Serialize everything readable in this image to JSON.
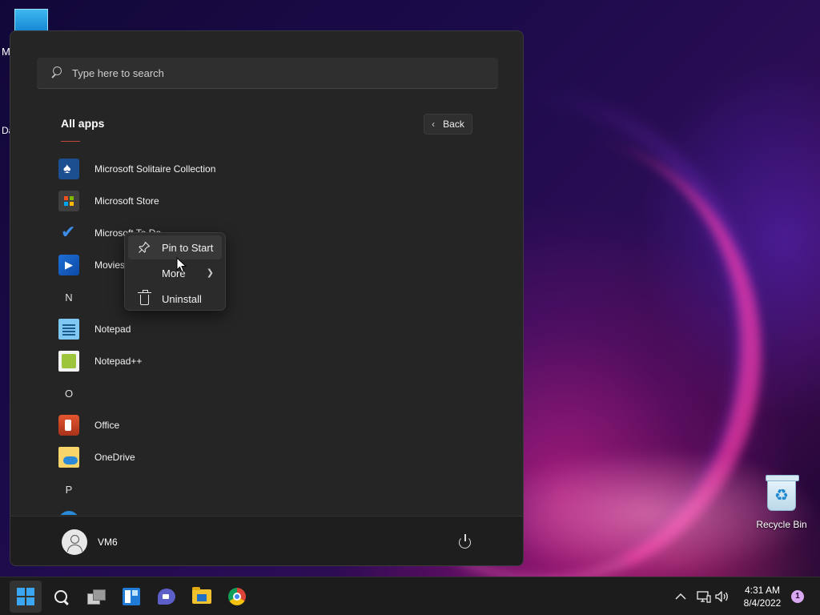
{
  "desktop": {
    "top_label_fragment": "M",
    "side_label_fragment": "Da",
    "recycle_bin_label": "Recycle Bin"
  },
  "start_menu": {
    "search": {
      "placeholder": "Type here to search",
      "value": ""
    },
    "title": "All apps",
    "back_label": "Back",
    "apps": [
      {
        "kind": "app",
        "label": "Microsoft Solitaire Collection",
        "icon": "solitaire-icon"
      },
      {
        "kind": "app",
        "label": "Microsoft Store",
        "icon": "store-icon"
      },
      {
        "kind": "app",
        "label": "Microsoft To Do",
        "icon": "todo-icon"
      },
      {
        "kind": "app",
        "label": "Movies & TV",
        "icon": "movies-icon"
      },
      {
        "kind": "letter",
        "label": "N"
      },
      {
        "kind": "app",
        "label": "Notepad",
        "icon": "notepad-icon"
      },
      {
        "kind": "app",
        "label": "Notepad++",
        "icon": "notepadpp-icon"
      },
      {
        "kind": "letter",
        "label": "O"
      },
      {
        "kind": "app",
        "label": "Office",
        "icon": "office-icon"
      },
      {
        "kind": "app",
        "label": "OneDrive",
        "icon": "onedrive-icon"
      },
      {
        "kind": "letter",
        "label": "P"
      }
    ],
    "user_name": "VM6"
  },
  "context_menu": {
    "items": [
      {
        "label": "Pin to Start",
        "icon": "pin-icon",
        "hover": true
      },
      {
        "label": "More",
        "icon": "none",
        "submenu": true
      },
      {
        "label": "Uninstall",
        "icon": "trash-icon"
      }
    ]
  },
  "taskbar": {
    "apps": [
      "start",
      "search",
      "task-view",
      "widgets",
      "chat",
      "file-explorer",
      "chrome"
    ],
    "clock_time": "4:31 AM",
    "clock_date": "8/4/2022",
    "notification_count": "1"
  },
  "colors": {
    "accent": "#3ba7f2",
    "menu_bg": "#252525",
    "taskbar_bg": "#1c1c1c"
  }
}
